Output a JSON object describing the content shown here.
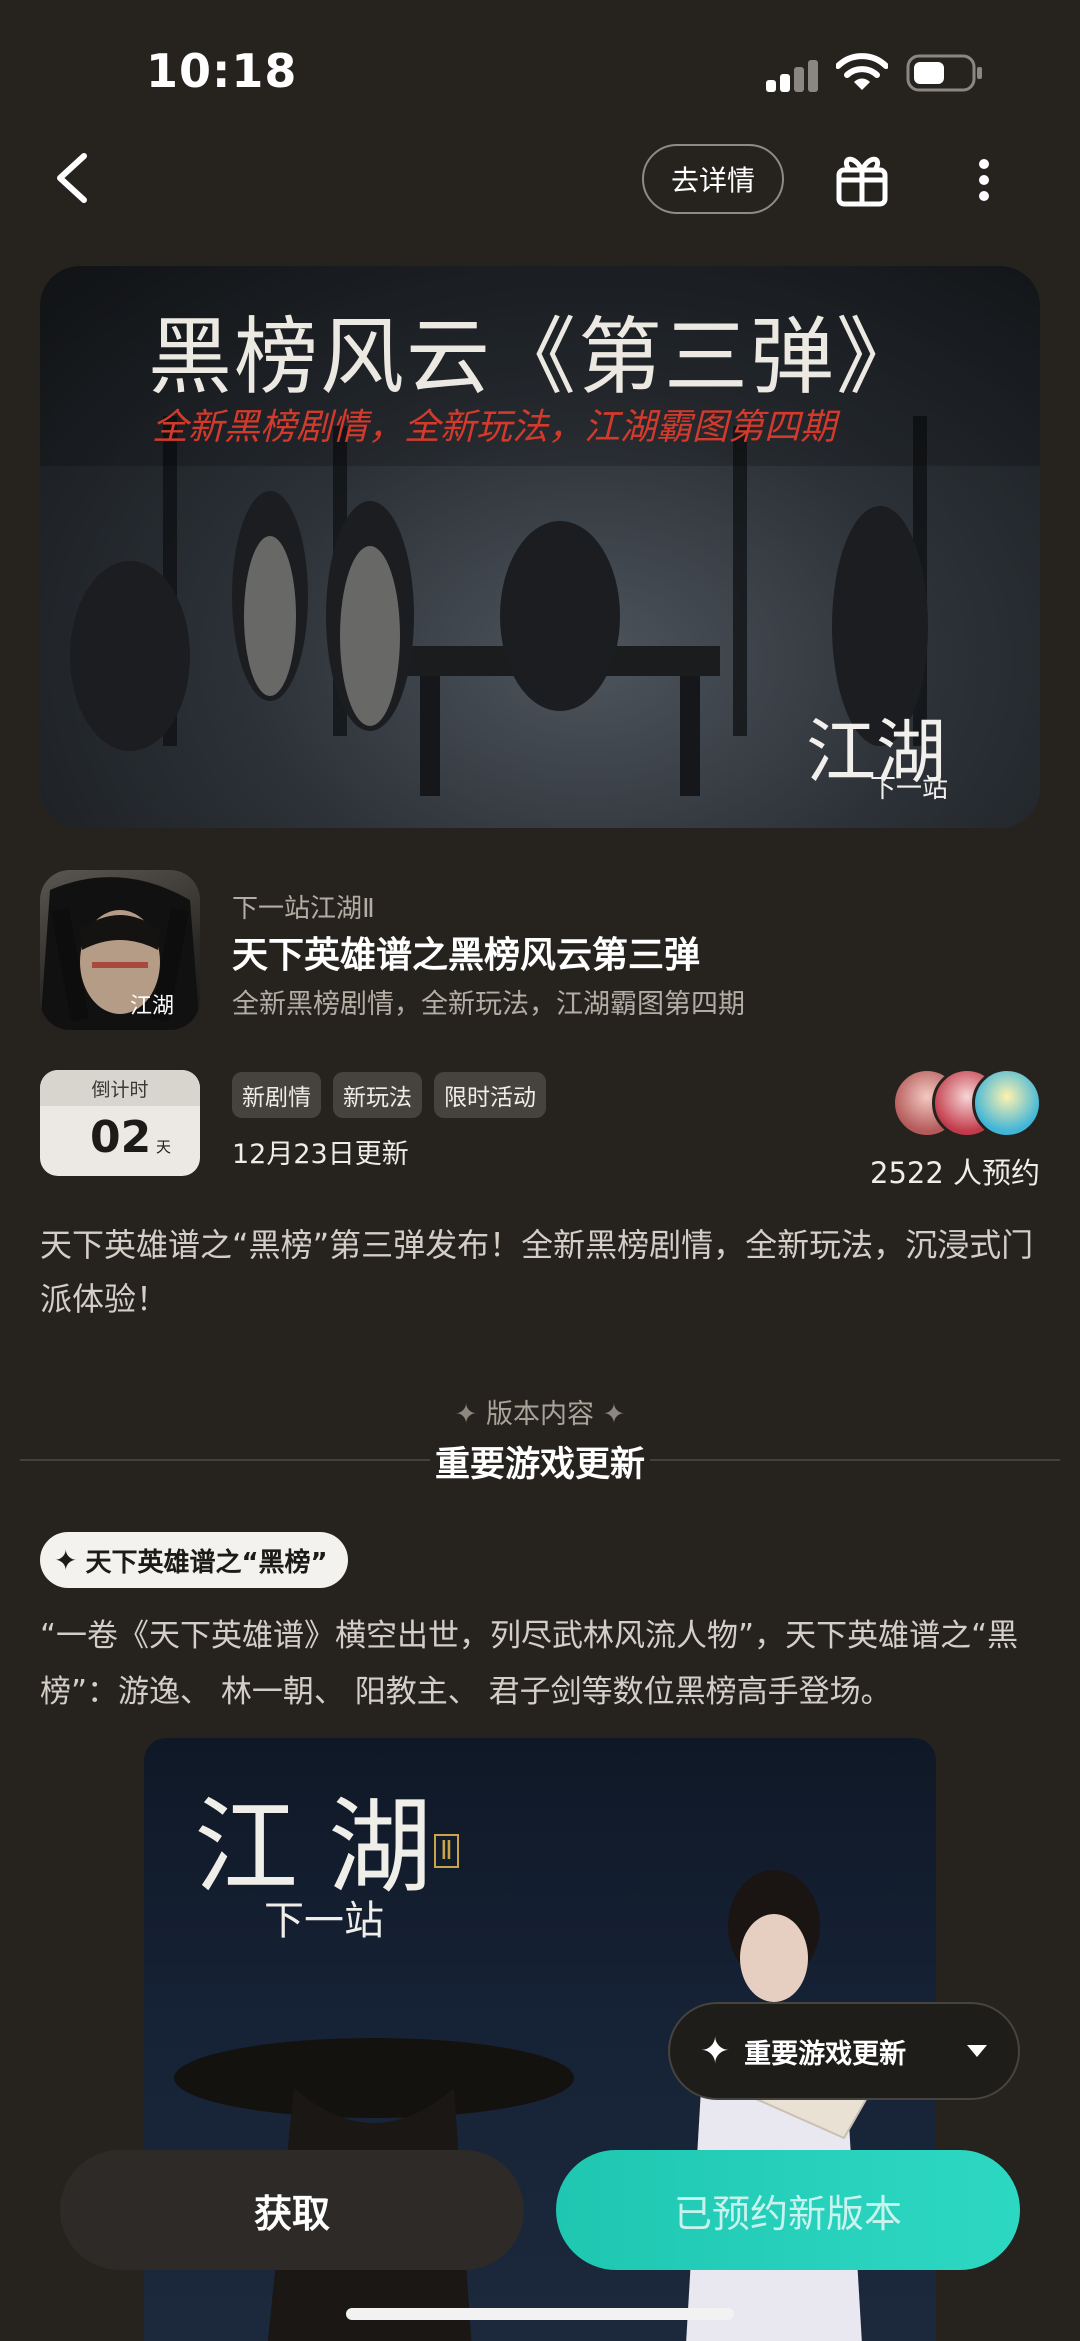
{
  "status_bar": {
    "time": "10:18"
  },
  "nav": {
    "detail_label": "去详情"
  },
  "banner": {
    "title": "黑榜风云《第三弹》",
    "subtitle": "全新黑榜剧情，全新玩法，江湖霸图第四期",
    "logo_main": "江湖",
    "logo_sub": "下一站"
  },
  "game": {
    "developer": "下一站江湖Ⅱ",
    "title": "天下英雄谱之黑榜风云第三弹",
    "description": "全新黑榜剧情，全新玩法，江湖霸图第四期",
    "icon_text": "江湖"
  },
  "countdown": {
    "label": "倒计时",
    "value": "02",
    "unit": "天"
  },
  "tags": [
    "新剧情",
    "新玩法",
    "限时活动"
  ],
  "update_date": "12月23日更新",
  "reservations": "2522 人预约",
  "intro": "天下英雄谱之“黑榜”第三弹发布！全新黑榜剧情，全新玩法，沉浸式门派体验！",
  "section": {
    "label": "版本内容",
    "title": "重要游戏更新"
  },
  "feature": {
    "pill_label": "天下英雄谱之“黑榜”",
    "text": "“一卷《天下英雄谱》横空出世，列尽武林风流人物”，天下英雄谱之“黑榜”：游逸、 林一朝、 阳教主、 君子剑等数位黑榜高手登场。"
  },
  "poster": {
    "logo_main": "江湖",
    "logo_sub": "下一站",
    "logo_badge": "Ⅱ"
  },
  "float_menu": {
    "label": "重要游戏更新"
  },
  "buttons": {
    "get": "获取",
    "reserved": "已预约新版本"
  },
  "colors": {
    "background": "#26231f",
    "accent": "#2dd8c2",
    "banner_subtitle": "#d43a2c"
  }
}
